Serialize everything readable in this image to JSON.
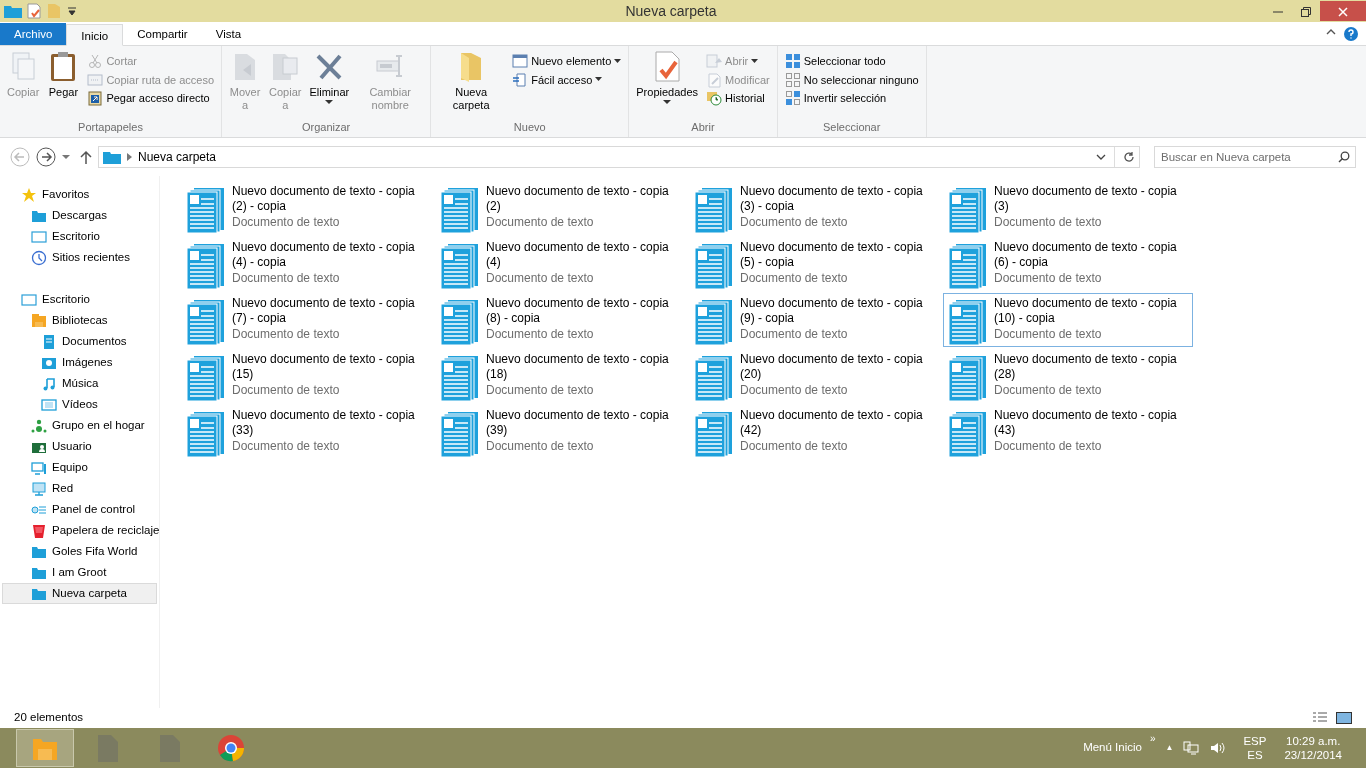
{
  "window": {
    "title": "Nueva carpeta"
  },
  "ribbon_tabs": [
    {
      "label": "Archivo",
      "kind": "file",
      "selected": false
    },
    {
      "label": "Inicio",
      "kind": "tab",
      "selected": true
    },
    {
      "label": "Compartir",
      "kind": "tab",
      "selected": false
    },
    {
      "label": "Vista",
      "kind": "tab",
      "selected": false
    }
  ],
  "ribbon_groups": [
    {
      "title": "Portapapeles",
      "buttons": [
        {
          "label": "Copiar",
          "kind": "large",
          "disabled": true
        },
        {
          "label": "Pegar",
          "kind": "large",
          "disabled": false
        },
        {
          "kind": "stack",
          "items": [
            {
              "label": "Cortar",
              "disabled": true
            },
            {
              "label": "Copiar ruta de acceso",
              "disabled": true
            },
            {
              "label": "Pegar acceso directo",
              "disabled": false
            }
          ]
        }
      ]
    },
    {
      "title": "Organizar",
      "buttons": [
        {
          "label": "Mover",
          "sub": "a",
          "kind": "large",
          "disabled": true
        },
        {
          "label": "Copiar",
          "sub": "a",
          "kind": "large",
          "disabled": true
        },
        {
          "label": "Eliminar",
          "kind": "large",
          "disabled": false,
          "dropdown": true
        },
        {
          "label": "Cambiar nombre",
          "kind": "large",
          "disabled": true
        }
      ]
    },
    {
      "title": "Nuevo",
      "buttons": [
        {
          "label": "Nueva carpeta",
          "kind": "large",
          "disabled": false
        },
        {
          "kind": "stack",
          "items": [
            {
              "label": "Nuevo elemento",
              "disabled": false,
              "dropdown": true
            },
            {
              "label": "Fácil acceso",
              "disabled": false,
              "dropdown": true
            }
          ]
        }
      ]
    },
    {
      "title": "Abrir",
      "buttons": [
        {
          "label": "Propiedades",
          "kind": "large",
          "disabled": false,
          "dropdown": true
        },
        {
          "kind": "stack",
          "items": [
            {
              "label": "Abrir",
              "disabled": true,
              "dropdown": true
            },
            {
              "label": "Modificar",
              "disabled": true
            },
            {
              "label": "Historial",
              "disabled": false
            }
          ]
        }
      ]
    },
    {
      "title": "Seleccionar",
      "buttons": [
        {
          "kind": "stack",
          "items": [
            {
              "label": "Seleccionar todo",
              "disabled": false
            },
            {
              "label": "No seleccionar ninguno",
              "disabled": false
            },
            {
              "label": "Invertir selección",
              "disabled": false
            }
          ]
        }
      ]
    }
  ],
  "address": {
    "path": "Nueva carpeta",
    "search_placeholder": "Buscar en Nueva carpeta"
  },
  "sidebar": {
    "items": [
      {
        "label": "Favoritos",
        "selected": false,
        "children": [
          {
            "label": "Descargas",
            "selected": false
          },
          {
            "label": "Escritorio",
            "selected": false
          },
          {
            "label": "Sitios recientes",
            "selected": false
          }
        ]
      },
      {
        "label": "Escritorio",
        "selected": false,
        "children": [
          {
            "label": "Bibliotecas",
            "selected": false,
            "children": [
              {
                "label": "Documentos",
                "selected": false
              },
              {
                "label": "Imágenes",
                "selected": false
              },
              {
                "label": "Música",
                "selected": false
              },
              {
                "label": "Vídeos",
                "selected": false
              }
            ]
          },
          {
            "label": "Grupo en el hogar",
            "selected": false
          },
          {
            "label": "Usuario",
            "selected": false
          },
          {
            "label": "Equipo",
            "selected": false
          },
          {
            "label": "Red",
            "selected": false
          },
          {
            "label": "Panel de control",
            "selected": false
          },
          {
            "label": "Papelera de reciclaje",
            "selected": false
          },
          {
            "label": "Goles Fifa World",
            "selected": false
          },
          {
            "label": "I am Groot",
            "selected": false
          },
          {
            "label": "Nueva carpeta",
            "selected": true
          }
        ]
      }
    ]
  },
  "files": [
    {
      "name": "Nuevo documento de texto - copia (2) - copia",
      "type": "Documento de texto",
      "selected": false
    },
    {
      "name": "Nuevo documento de texto - copia (2)",
      "type": "Documento de texto",
      "selected": false
    },
    {
      "name": "Nuevo documento de texto - copia (3) - copia",
      "type": "Documento de texto",
      "selected": false
    },
    {
      "name": "Nuevo documento de texto - copia (3)",
      "type": "Documento de texto",
      "selected": false
    },
    {
      "name": "Nuevo documento de texto - copia (4) - copia",
      "type": "Documento de texto",
      "selected": false
    },
    {
      "name": "Nuevo documento de texto - copia (4)",
      "type": "Documento de texto",
      "selected": false
    },
    {
      "name": "Nuevo documento de texto - copia (5) - copia",
      "type": "Documento de texto",
      "selected": false
    },
    {
      "name": "Nuevo documento de texto - copia (6) - copia",
      "type": "Documento de texto",
      "selected": false
    },
    {
      "name": "Nuevo documento de texto - copia (7) - copia",
      "type": "Documento de texto",
      "selected": false
    },
    {
      "name": "Nuevo documento de texto - copia (8) - copia",
      "type": "Documento de texto",
      "selected": false
    },
    {
      "name": "Nuevo documento de texto - copia (9) - copia",
      "type": "Documento de texto",
      "selected": false
    },
    {
      "name": "Nuevo documento de texto - copia (10) - copia",
      "type": "Documento de texto",
      "selected": true
    },
    {
      "name": "Nuevo documento de texto - copia (15)",
      "type": "Documento de texto",
      "selected": false
    },
    {
      "name": "Nuevo documento de texto - copia (18)",
      "type": "Documento de texto",
      "selected": false
    },
    {
      "name": "Nuevo documento de texto - copia (20)",
      "type": "Documento de texto",
      "selected": false
    },
    {
      "name": "Nuevo documento de texto - copia (28)",
      "type": "Documento de texto",
      "selected": false
    },
    {
      "name": "Nuevo documento de texto - copia (33)",
      "type": "Documento de texto",
      "selected": false
    },
    {
      "name": "Nuevo documento de texto - copia (39)",
      "type": "Documento de texto",
      "selected": false
    },
    {
      "name": "Nuevo documento de texto - copia (42)",
      "type": "Documento de texto",
      "selected": false
    },
    {
      "name": "Nuevo documento de texto - copia (43)",
      "type": "Documento de texto",
      "selected": false
    }
  ],
  "status_bar": {
    "count": "20 elementos"
  },
  "taskbar": {
    "apps": [
      {
        "kind": "explorer",
        "selected": true
      },
      {
        "kind": "file",
        "selected": false
      },
      {
        "kind": "file",
        "selected": false
      },
      {
        "kind": "browser",
        "selected": false
      }
    ],
    "start_menu": "Menú Inicio",
    "chevron": "»",
    "tray_arrow": "▲",
    "lang_top": "ESP",
    "lang_bottom": "ES",
    "time": "10:29 a.m.",
    "date": "23/12/2014"
  }
}
